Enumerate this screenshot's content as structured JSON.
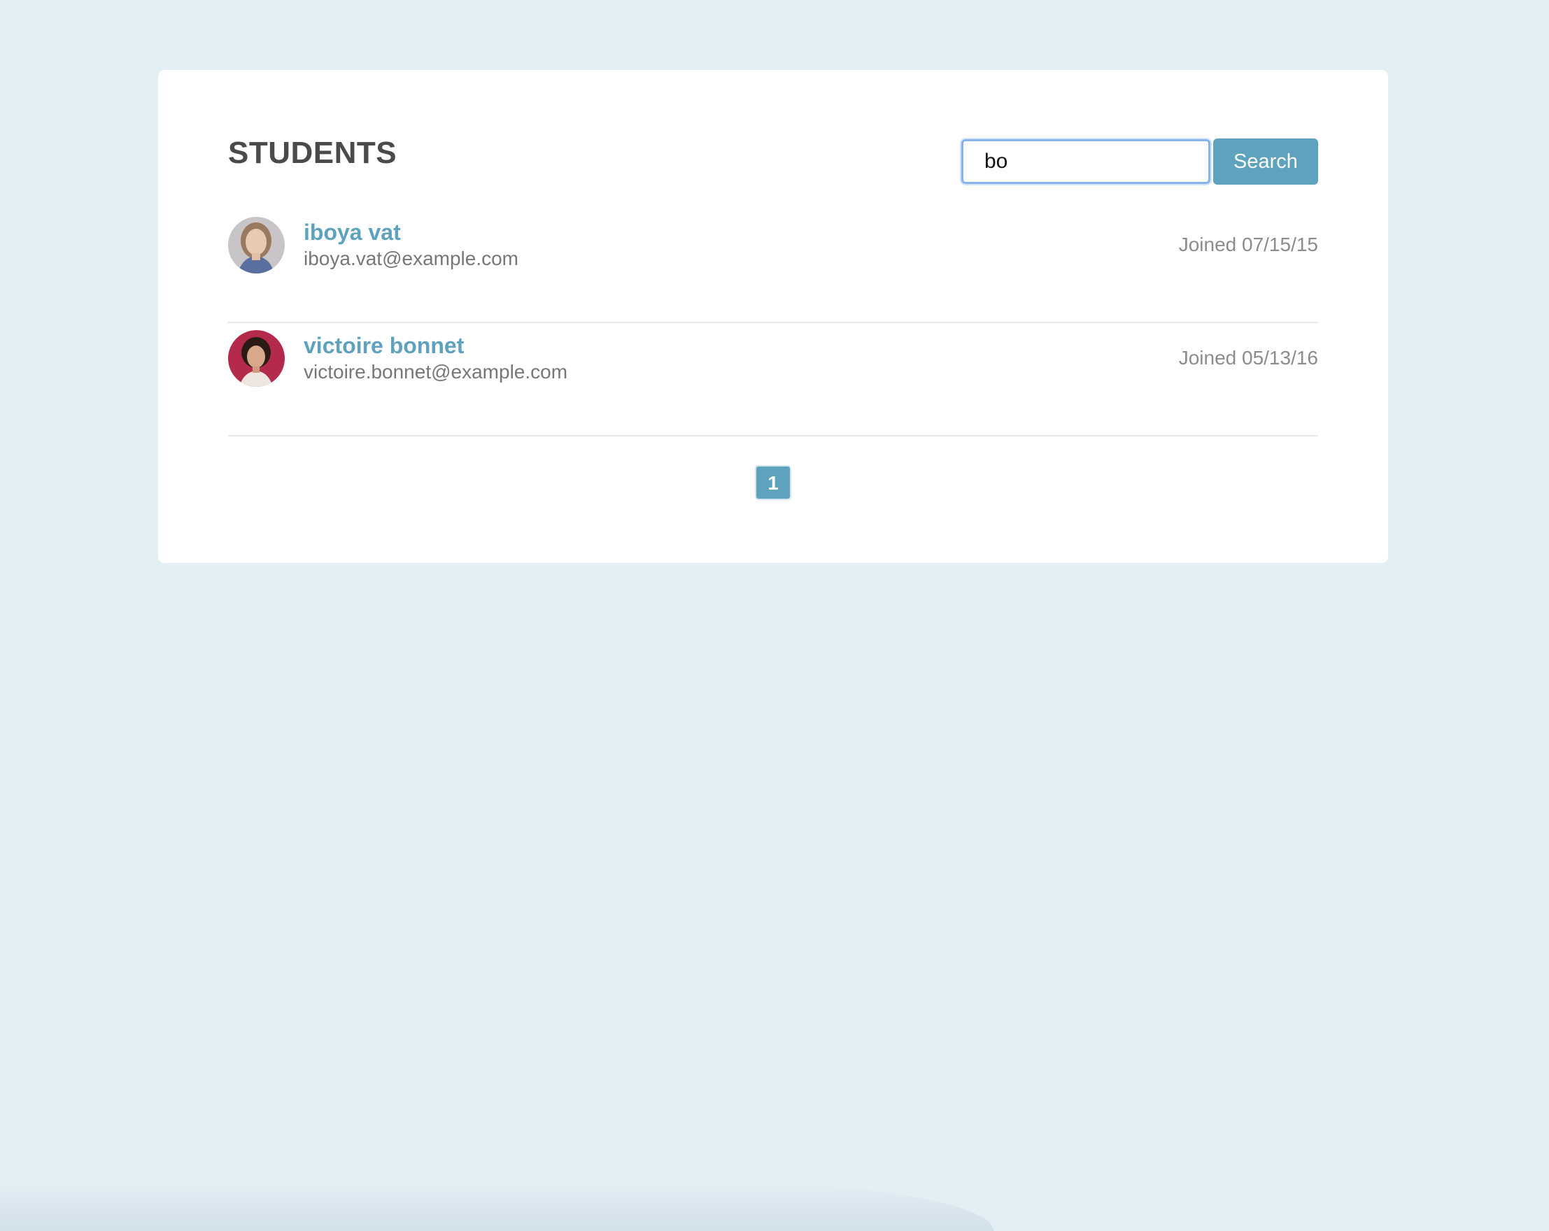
{
  "header": {
    "title": "STUDENTS"
  },
  "search": {
    "value": "bo",
    "button_label": "Search"
  },
  "students": [
    {
      "name": "iboya vat",
      "email": "iboya.vat@example.com",
      "joined": "Joined 07/15/15",
      "avatar_icon": "woman-portrait-avatar"
    },
    {
      "name": "victoire bonnet",
      "email": "victoire.bonnet@example.com",
      "joined": "Joined 05/13/16",
      "avatar_icon": "woman-portrait-avatar"
    }
  ],
  "pagination": {
    "current_page": "1"
  },
  "colors": {
    "background": "#e2eff5",
    "card": "#ffffff",
    "accent": "#5fa2be",
    "title_text": "#4a4a4a",
    "focus_ring": "#86b4ea"
  }
}
